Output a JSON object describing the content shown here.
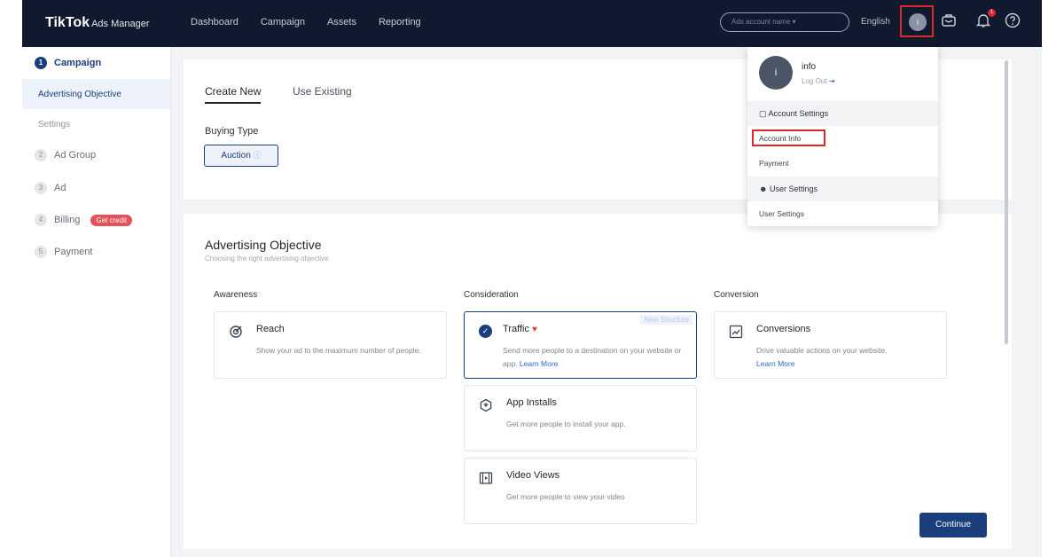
{
  "header": {
    "logo": "TikTok",
    "logo_sub": "Ads Manager",
    "nav": [
      "Dashboard",
      "Campaign",
      "Assets",
      "Reporting"
    ],
    "account_select": "Ads account name ▾",
    "language": "English",
    "avatar_initial": "i",
    "notification_count": "1"
  },
  "sidebar": {
    "steps": [
      {
        "num": "1",
        "label": "Campaign"
      },
      {
        "num": "2",
        "label": "Ad Group"
      },
      {
        "num": "3",
        "label": "Ad"
      },
      {
        "num": "4",
        "label": "Billing"
      },
      {
        "num": "5",
        "label": "Payment"
      }
    ],
    "sub_items": [
      "Advertising Objective",
      "Settings"
    ],
    "credit_badge": "Get credit"
  },
  "card1": {
    "tabs": [
      "Create New",
      "Use Existing"
    ],
    "buying_type_label": "Buying Type",
    "buying_type_value": "Auction"
  },
  "objective": {
    "title": "Advertising Objective",
    "subtitle": "Choosing the right advertising objective",
    "columns": [
      "Awareness",
      "Consideration",
      "Conversion"
    ],
    "options": [
      {
        "title": "Reach",
        "desc": "Show your ad to the maximum number of people."
      },
      {
        "title": "Traffic",
        "desc": "Send more people to a destination on your website or app.",
        "link": "Learn More",
        "tag": "New Structure"
      },
      {
        "title": "App Installs",
        "desc": "Get more people to install your app."
      },
      {
        "title": "Video Views",
        "desc": "Get more people to view your video"
      },
      {
        "title": "Conversions",
        "desc": "Drive valuable actions on your website.",
        "link": "Learn More"
      }
    ]
  },
  "continue_label": "Continue",
  "dropdown": {
    "name": "info",
    "logout": "Log Out",
    "account_settings": "Account Settings",
    "account_info": "Account Info",
    "payment": "Payment",
    "user_settings_header": "User Settings",
    "user_settings_item": "User Settings"
  },
  "colors": {
    "topbar": "#0f1a2e",
    "accent": "#1a3d7c",
    "highlight": "#e0262b"
  }
}
